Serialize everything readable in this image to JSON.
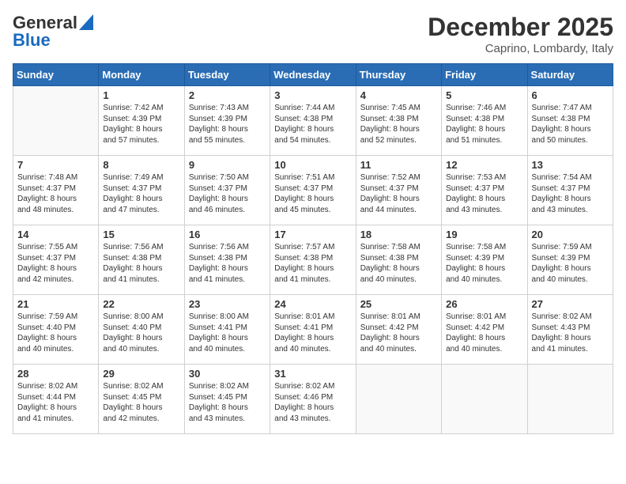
{
  "header": {
    "logo_line1": "General",
    "logo_line2": "Blue",
    "month": "December 2025",
    "location": "Caprino, Lombardy, Italy"
  },
  "days_of_week": [
    "Sunday",
    "Monday",
    "Tuesday",
    "Wednesday",
    "Thursday",
    "Friday",
    "Saturday"
  ],
  "weeks": [
    [
      {
        "day": "",
        "info": ""
      },
      {
        "day": "1",
        "info": "Sunrise: 7:42 AM\nSunset: 4:39 PM\nDaylight: 8 hours\nand 57 minutes."
      },
      {
        "day": "2",
        "info": "Sunrise: 7:43 AM\nSunset: 4:39 PM\nDaylight: 8 hours\nand 55 minutes."
      },
      {
        "day": "3",
        "info": "Sunrise: 7:44 AM\nSunset: 4:38 PM\nDaylight: 8 hours\nand 54 minutes."
      },
      {
        "day": "4",
        "info": "Sunrise: 7:45 AM\nSunset: 4:38 PM\nDaylight: 8 hours\nand 52 minutes."
      },
      {
        "day": "5",
        "info": "Sunrise: 7:46 AM\nSunset: 4:38 PM\nDaylight: 8 hours\nand 51 minutes."
      },
      {
        "day": "6",
        "info": "Sunrise: 7:47 AM\nSunset: 4:38 PM\nDaylight: 8 hours\nand 50 minutes."
      }
    ],
    [
      {
        "day": "7",
        "info": "Sunrise: 7:48 AM\nSunset: 4:37 PM\nDaylight: 8 hours\nand 48 minutes."
      },
      {
        "day": "8",
        "info": "Sunrise: 7:49 AM\nSunset: 4:37 PM\nDaylight: 8 hours\nand 47 minutes."
      },
      {
        "day": "9",
        "info": "Sunrise: 7:50 AM\nSunset: 4:37 PM\nDaylight: 8 hours\nand 46 minutes."
      },
      {
        "day": "10",
        "info": "Sunrise: 7:51 AM\nSunset: 4:37 PM\nDaylight: 8 hours\nand 45 minutes."
      },
      {
        "day": "11",
        "info": "Sunrise: 7:52 AM\nSunset: 4:37 PM\nDaylight: 8 hours\nand 44 minutes."
      },
      {
        "day": "12",
        "info": "Sunrise: 7:53 AM\nSunset: 4:37 PM\nDaylight: 8 hours\nand 43 minutes."
      },
      {
        "day": "13",
        "info": "Sunrise: 7:54 AM\nSunset: 4:37 PM\nDaylight: 8 hours\nand 43 minutes."
      }
    ],
    [
      {
        "day": "14",
        "info": "Sunrise: 7:55 AM\nSunset: 4:37 PM\nDaylight: 8 hours\nand 42 minutes."
      },
      {
        "day": "15",
        "info": "Sunrise: 7:56 AM\nSunset: 4:38 PM\nDaylight: 8 hours\nand 41 minutes."
      },
      {
        "day": "16",
        "info": "Sunrise: 7:56 AM\nSunset: 4:38 PM\nDaylight: 8 hours\nand 41 minutes."
      },
      {
        "day": "17",
        "info": "Sunrise: 7:57 AM\nSunset: 4:38 PM\nDaylight: 8 hours\nand 41 minutes."
      },
      {
        "day": "18",
        "info": "Sunrise: 7:58 AM\nSunset: 4:38 PM\nDaylight: 8 hours\nand 40 minutes."
      },
      {
        "day": "19",
        "info": "Sunrise: 7:58 AM\nSunset: 4:39 PM\nDaylight: 8 hours\nand 40 minutes."
      },
      {
        "day": "20",
        "info": "Sunrise: 7:59 AM\nSunset: 4:39 PM\nDaylight: 8 hours\nand 40 minutes."
      }
    ],
    [
      {
        "day": "21",
        "info": "Sunrise: 7:59 AM\nSunset: 4:40 PM\nDaylight: 8 hours\nand 40 minutes."
      },
      {
        "day": "22",
        "info": "Sunrise: 8:00 AM\nSunset: 4:40 PM\nDaylight: 8 hours\nand 40 minutes."
      },
      {
        "day": "23",
        "info": "Sunrise: 8:00 AM\nSunset: 4:41 PM\nDaylight: 8 hours\nand 40 minutes."
      },
      {
        "day": "24",
        "info": "Sunrise: 8:01 AM\nSunset: 4:41 PM\nDaylight: 8 hours\nand 40 minutes."
      },
      {
        "day": "25",
        "info": "Sunrise: 8:01 AM\nSunset: 4:42 PM\nDaylight: 8 hours\nand 40 minutes."
      },
      {
        "day": "26",
        "info": "Sunrise: 8:01 AM\nSunset: 4:42 PM\nDaylight: 8 hours\nand 40 minutes."
      },
      {
        "day": "27",
        "info": "Sunrise: 8:02 AM\nSunset: 4:43 PM\nDaylight: 8 hours\nand 41 minutes."
      }
    ],
    [
      {
        "day": "28",
        "info": "Sunrise: 8:02 AM\nSunset: 4:44 PM\nDaylight: 8 hours\nand 41 minutes."
      },
      {
        "day": "29",
        "info": "Sunrise: 8:02 AM\nSunset: 4:45 PM\nDaylight: 8 hours\nand 42 minutes."
      },
      {
        "day": "30",
        "info": "Sunrise: 8:02 AM\nSunset: 4:45 PM\nDaylight: 8 hours\nand 43 minutes."
      },
      {
        "day": "31",
        "info": "Sunrise: 8:02 AM\nSunset: 4:46 PM\nDaylight: 8 hours\nand 43 minutes."
      },
      {
        "day": "",
        "info": ""
      },
      {
        "day": "",
        "info": ""
      },
      {
        "day": "",
        "info": ""
      }
    ]
  ]
}
